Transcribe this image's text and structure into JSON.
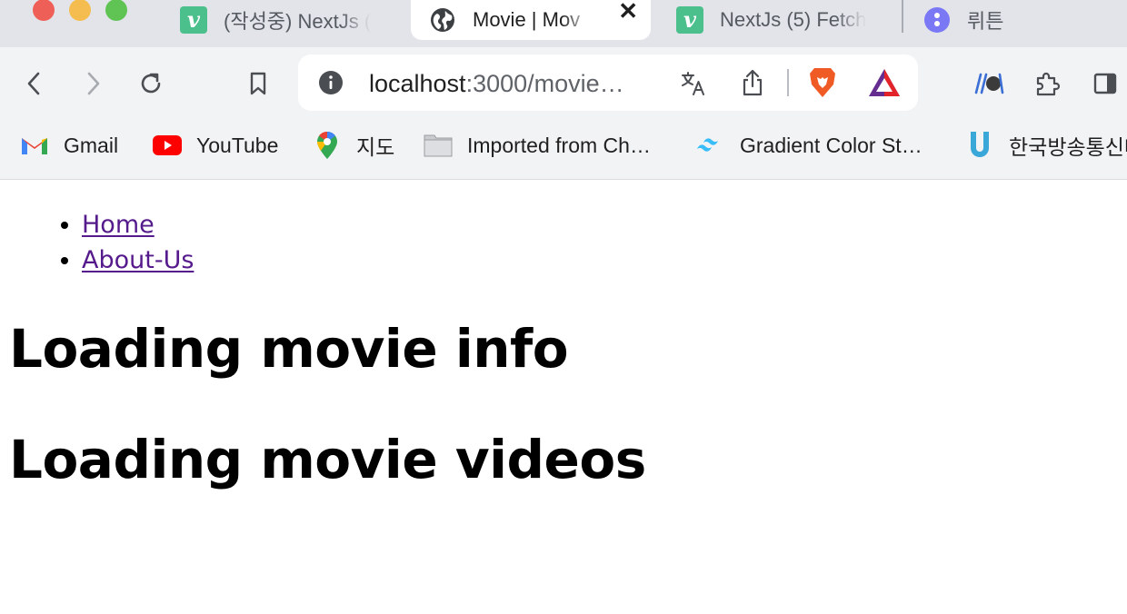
{
  "browser": {
    "tabs": [
      {
        "title": "(작성중) NextJs (",
        "icon": "vuepress-v-icon",
        "active": false
      },
      {
        "title": "Movie | Mov",
        "icon": "globe-icon",
        "active": true
      },
      {
        "title": "NextJs (5) Fetch",
        "icon": "vuepress-v-icon",
        "active": false
      },
      {
        "title": "뤼튼",
        "icon": "wrtn-icon",
        "active": false
      }
    ],
    "close_glyph": "✕",
    "address": {
      "host": "localhost",
      "path": ":3000/movie…"
    },
    "bookmarks": [
      {
        "label": "Gmail",
        "icon": "gmail-icon"
      },
      {
        "label": "YouTube",
        "icon": "youtube-icon"
      },
      {
        "label": "지도",
        "icon": "google-maps-icon"
      },
      {
        "label": "Imported from Ch…",
        "icon": "folder-icon"
      },
      {
        "label": "Gradient Color St…",
        "icon": "tailwind-icon"
      },
      {
        "label": "한국방송통신대",
        "icon": "knou-u-icon"
      }
    ]
  },
  "page": {
    "nav": [
      {
        "label": "Home"
      },
      {
        "label": "About-Us"
      }
    ],
    "headings": [
      "Loading movie info",
      "Loading movie videos"
    ]
  },
  "colors": {
    "link": "#551a8b",
    "tabstrip": "#e2e4e9",
    "toolbar": "#f2f3f5"
  }
}
